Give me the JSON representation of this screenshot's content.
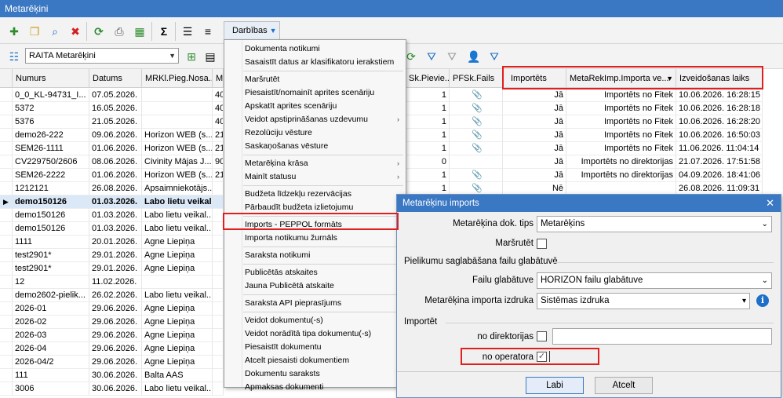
{
  "window": {
    "title": "Metarēķini"
  },
  "toolbar": {
    "actions_label": "Darbības",
    "icons": [
      "add-icon",
      "copy-icon",
      "find-icon",
      "delete-icon",
      "refresh-icon",
      "print-icon",
      "export-icon",
      "sum-icon",
      "list-icon",
      "tree-icon"
    ]
  },
  "toolbar2": {
    "view_select": "RAITA Metarēķini"
  },
  "grid": {
    "headers_left": [
      "Numurs",
      "Datums",
      "MRKl.Pieg.Nosa...",
      "M"
    ],
    "headers_right": [
      "Sk.Pievie...",
      "PFSk.Fails",
      "Importēts",
      "MetaRekImp.Importa ve...",
      "Izveidošanas laiks"
    ],
    "rows": [
      {
        "numurs": "0_0_KL-94731_I...",
        "datums": "07.05.2026.",
        "pieg": "",
        "m": "40",
        "sk": "1",
        "fails": true,
        "imp": "Jā",
        "importa": "Importēts no Fitek",
        "laiks": "10.06.2026. 16:28:15"
      },
      {
        "numurs": "5372",
        "datums": "16.05.2026.",
        "pieg": "",
        "m": "40",
        "sk": "1",
        "fails": true,
        "imp": "Jā",
        "importa": "Importēts no Fitek",
        "laiks": "10.06.2026. 16:28:18"
      },
      {
        "numurs": "5376",
        "datums": "21.05.2026.",
        "pieg": "",
        "m": "40",
        "sk": "1",
        "fails": true,
        "imp": "Jā",
        "importa": "Importēts no Fitek",
        "laiks": "10.06.2026. 16:28:20"
      },
      {
        "numurs": "demo26-222",
        "datums": "09.06.2026.",
        "pieg": "Horizon WEB (s...",
        "m": "21",
        "sk": "1",
        "fails": true,
        "imp": "Jā",
        "importa": "Importēts no Fitek",
        "laiks": "10.06.2026. 16:50:03"
      },
      {
        "numurs": "SEM26-1111",
        "datums": "01.06.2026.",
        "pieg": "Horizon WEB (s...",
        "m": "21",
        "sk": "1",
        "fails": true,
        "imp": "Jā",
        "importa": "Importēts no Fitek",
        "laiks": "11.06.2026. 11:04:14"
      },
      {
        "numurs": "CV229750/2606",
        "datums": "08.06.2026.",
        "pieg": "Civinity Mājas J...",
        "m": "90",
        "sk": "0",
        "fails": false,
        "imp": "Jā",
        "importa": "Importēts no direktorijas",
        "laiks": "21.07.2026. 17:51:58"
      },
      {
        "numurs": "SEM26-2222",
        "datums": "01.06.2026.",
        "pieg": "Horizon WEB (s...",
        "m": "21",
        "sk": "1",
        "fails": true,
        "imp": "Jā",
        "importa": "Importēts no direktorijas",
        "laiks": "04.09.2026. 18:41:06"
      },
      {
        "numurs": "1212121",
        "datums": "26.08.2026.",
        "pieg": "Apsaimniekotājs...",
        "m": "",
        "sk": "1",
        "fails": true,
        "imp": "Nē",
        "importa": "",
        "laiks": "26.08.2026. 11:09:31"
      },
      {
        "numurs": "demo150126",
        "datums": "01.03.2026.",
        "pieg": "Labo lietu veikal...",
        "m": "",
        "sk": "",
        "fails": false,
        "imp": "",
        "importa": "",
        "laiks": ""
      },
      {
        "numurs": "demo150126",
        "datums": "01.03.2026.",
        "pieg": "Labo lietu veikal...",
        "m": "",
        "sk": "",
        "fails": false,
        "imp": "",
        "importa": "",
        "laiks": ""
      },
      {
        "numurs": "demo150126",
        "datums": "01.03.2026.",
        "pieg": "Labo lietu veikal...",
        "m": "",
        "sk": "",
        "fails": false,
        "imp": "",
        "importa": "",
        "laiks": ""
      },
      {
        "numurs": "1111",
        "datums": "20.01.2026.",
        "pieg": "Agne Liepiņa",
        "m": "",
        "sk": "",
        "fails": false,
        "imp": "",
        "importa": "",
        "laiks": ""
      },
      {
        "numurs": "test2901*",
        "datums": "29.01.2026.",
        "pieg": "Agne Liepiņa",
        "m": "",
        "sk": "",
        "fails": false,
        "imp": "",
        "importa": "",
        "laiks": ""
      },
      {
        "numurs": "test2901*",
        "datums": "29.01.2026.",
        "pieg": "Agne Liepiņa",
        "m": "",
        "sk": "",
        "fails": false,
        "imp": "",
        "importa": "",
        "laiks": ""
      },
      {
        "numurs": "12",
        "datums": "11.02.2026.",
        "pieg": "",
        "m": "",
        "sk": "",
        "fails": false,
        "imp": "",
        "importa": "",
        "laiks": ""
      },
      {
        "numurs": "demo2602-pielik...",
        "datums": "26.02.2026.",
        "pieg": "Labo lietu veikal...",
        "m": "",
        "sk": "",
        "fails": false,
        "imp": "",
        "importa": "",
        "laiks": ""
      },
      {
        "numurs": "2026-01",
        "datums": "29.06.2026.",
        "pieg": "Agne Liepiņa",
        "m": "",
        "sk": "",
        "fails": false,
        "imp": "",
        "importa": "",
        "laiks": ""
      },
      {
        "numurs": "2026-02",
        "datums": "29.06.2026.",
        "pieg": "Agne Liepiņa",
        "m": "",
        "sk": "",
        "fails": false,
        "imp": "",
        "importa": "",
        "laiks": ""
      },
      {
        "numurs": "2026-03",
        "datums": "29.06.2026.",
        "pieg": "Agne Liepiņa",
        "m": "",
        "sk": "",
        "fails": false,
        "imp": "",
        "importa": "",
        "laiks": ""
      },
      {
        "numurs": "2026-04",
        "datums": "29.06.2026.",
        "pieg": "Agne Liepiņa",
        "m": "",
        "sk": "",
        "fails": false,
        "imp": "",
        "importa": "",
        "laiks": ""
      },
      {
        "numurs": "2026-04/2",
        "datums": "29.06.2026.",
        "pieg": "Agne Liepiņa",
        "m": "",
        "sk": "",
        "fails": false,
        "imp": "",
        "importa": "",
        "laiks": ""
      },
      {
        "numurs": "111",
        "datums": "30.06.2026.",
        "pieg": "Balta AAS",
        "m": "",
        "sk": "",
        "fails": false,
        "imp": "",
        "importa": "",
        "laiks": ""
      },
      {
        "numurs": "3006",
        "datums": "30.06.2026.",
        "pieg": "Labo lietu veikal...",
        "m": "",
        "sk": "",
        "fails": false,
        "imp": "",
        "importa": "",
        "laiks": ""
      }
    ],
    "selected_row": 8
  },
  "menu": {
    "items": [
      {
        "label": "Dokumenta notikumi",
        "sub": false
      },
      {
        "label": "Sasaistīt datus ar klasifikatoru ierakstiem",
        "sub": false
      },
      {
        "sep": true
      },
      {
        "label": "Maršrutēt",
        "sub": false
      },
      {
        "label": "Piesaistīt/nomainīt aprites scenāriju",
        "sub": false
      },
      {
        "label": "Apskatīt aprites scenāriju",
        "sub": false
      },
      {
        "label": "Veidot apstiprināšanas uzdevumu",
        "sub": true
      },
      {
        "label": "Rezolūciju vēsture",
        "sub": false
      },
      {
        "label": "Saskaņošanas vēsture",
        "sub": false
      },
      {
        "sep": true
      },
      {
        "label": "Metarēķina krāsa",
        "sub": true
      },
      {
        "label": "Mainīt statusu",
        "sub": true
      },
      {
        "sep": true
      },
      {
        "label": "Budžeta līdzekļu rezervācijas",
        "sub": false
      },
      {
        "label": "Pārbaudīt budžeta izlietojumu",
        "sub": false
      },
      {
        "sep": true
      },
      {
        "label": "Imports - PEPPOL formāts",
        "sub": false
      },
      {
        "label": "Importa notikumu žurnāls",
        "sub": false
      },
      {
        "sep": true
      },
      {
        "label": "Saraksta notikumi",
        "sub": false
      },
      {
        "sep": true
      },
      {
        "label": "Publicētās atskaites",
        "sub": false
      },
      {
        "label": "Jauna Publicētā atskaite",
        "sub": false
      },
      {
        "sep": true
      },
      {
        "label": "Saraksta API pieprasījums",
        "sub": false
      },
      {
        "sep": true
      },
      {
        "label": "Veidot dokumentu(-s)",
        "sub": false
      },
      {
        "label": "Veidot norādītā tipa dokumentu(-s)",
        "sub": false
      },
      {
        "label": "Piesaistīt dokumentu",
        "sub": false
      },
      {
        "label": "Atcelt piesaisti dokumentiem",
        "sub": false
      },
      {
        "label": "Dokumentu saraksts",
        "sub": false
      },
      {
        "label": "Apmaksas dokumenti",
        "sub": false
      }
    ]
  },
  "dialog": {
    "title": "Metarēķinu imports",
    "doc_type_label": "Metarēķina dok. tips",
    "doc_type_value": "Metarēķins",
    "route_label": "Maršrutēt",
    "storage_section": "Pielikumu saglabāšana failu glabātuvē",
    "storage_label": "Failu glabātuve",
    "storage_value": "HORIZON failu glabātuve",
    "source_label": "Metarēķina importa izdruka",
    "source_value": "Sistēmas izdruka",
    "import_section": "Importēt",
    "dir_label": "no direktorijas",
    "dir_value": "",
    "operator_label": "no operatora",
    "operator_check": "✓",
    "ok_label": "Labi",
    "cancel_label": "Atcelt"
  },
  "colors": {
    "accent": "#3a78c3",
    "highlight": "#e0201e",
    "selection": "#dbe8f7"
  }
}
